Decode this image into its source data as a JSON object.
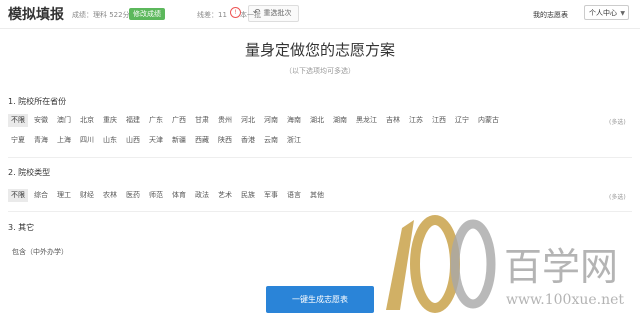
{
  "header": {
    "title": "模拟填报",
    "score": "成绩：理科 522分",
    "badge": "修改成绩",
    "rank": "线差：11",
    "batch": "本一批",
    "reselect": "重选批次",
    "my_plan": "我的志愿表",
    "user_center": "个人中心"
  },
  "main": {
    "heading": "量身定做您的志愿方案",
    "subheading": "（以下选项均可多选）",
    "sections": [
      {
        "title": "1. 院校所在省份",
        "multi": "(多选)",
        "rows": [
          [
            "不限",
            "安徽",
            "澳门",
            "北京",
            "重庆",
            "福建",
            "广东",
            "广西",
            "甘肃",
            "贵州",
            "河北",
            "河南",
            "海南",
            "湖北",
            "湖南",
            "黑龙江",
            "吉林",
            "江苏",
            "江西",
            "辽宁",
            "内蒙古"
          ],
          [
            "宁夏",
            "青海",
            "上海",
            "四川",
            "山东",
            "山西",
            "天津",
            "新疆",
            "西藏",
            "陕西",
            "香港",
            "云南",
            "浙江"
          ]
        ]
      },
      {
        "title": "2. 院校类型",
        "multi": "(多选)",
        "rows": [
          [
            "不限",
            "综合",
            "理工",
            "财经",
            "农林",
            "医药",
            "师范",
            "体育",
            "政法",
            "艺术",
            "民族",
            "军事",
            "语言",
            "其他"
          ]
        ]
      },
      {
        "title": "3. 其它",
        "note": "包含（中外办学）"
      }
    ],
    "generate_button": "一键生成志愿表"
  },
  "watermark": {
    "brand_cn": "百学网",
    "url": "www.100xue.net",
    "colors": {
      "gold": "#c9a24a",
      "gray": "#a7a7a7"
    }
  },
  "colors": {
    "accent": "#2a84d8",
    "badge": "#5cb85c",
    "warn": "#e55555"
  },
  "icons": {
    "reselect": "undo-arrow-icon",
    "warn": "alert-circle-icon",
    "caret": "chevron-down-icon"
  }
}
